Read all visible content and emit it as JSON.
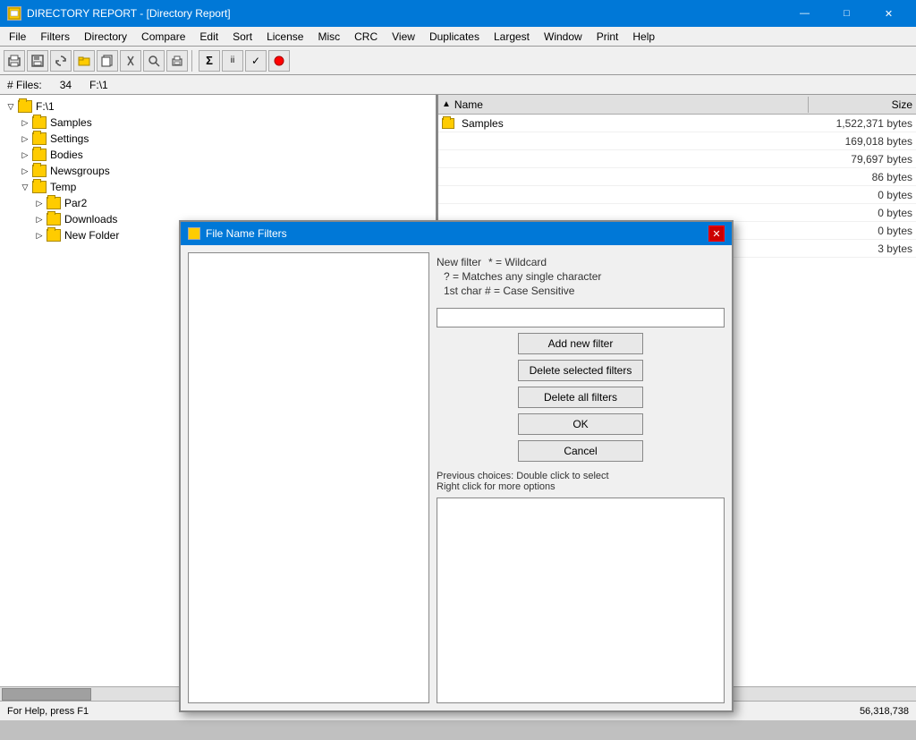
{
  "app": {
    "title": "DIRECTORY REPORT - [Directory Report]",
    "icon": "DR"
  },
  "titlebar": {
    "minimize": "—",
    "maximize": "□",
    "close": "✕"
  },
  "menubar": {
    "items": [
      "File",
      "Filters",
      "Directory",
      "Compare",
      "Edit",
      "Sort",
      "License",
      "Misc",
      "CRC",
      "View",
      "Duplicates",
      "Largest",
      "Window",
      "Print",
      "Help"
    ]
  },
  "fileinfo": {
    "files_label": "# Files:",
    "files_count": "34",
    "path": "F:\\1"
  },
  "tree": {
    "root": "F:\\1",
    "items": [
      {
        "label": "Samples",
        "indent": 1
      },
      {
        "label": "Settings",
        "indent": 1
      },
      {
        "label": "Bodies",
        "indent": 1
      },
      {
        "label": "Newsgroups",
        "indent": 1
      },
      {
        "label": "Temp",
        "indent": 1
      },
      {
        "label": "Par2",
        "indent": 2
      },
      {
        "label": "Downloads",
        "indent": 2
      },
      {
        "label": "New Folder",
        "indent": 2
      }
    ]
  },
  "filelist": {
    "header": {
      "name": "Name",
      "size": "Size"
    },
    "rows": [
      {
        "name": "Samples",
        "size": "1,522,371 bytes",
        "isFolder": true
      },
      {
        "name": "",
        "size": "169,018 bytes",
        "isFolder": false
      },
      {
        "name": "",
        "size": "79,697 bytes",
        "isFolder": false
      },
      {
        "name": "",
        "size": "86 bytes",
        "isFolder": false
      },
      {
        "name": "",
        "size": "0 bytes",
        "isFolder": false
      },
      {
        "name": "",
        "size": "0 bytes",
        "isFolder": false
      },
      {
        "name": "",
        "size": "0 bytes",
        "isFolder": false
      },
      {
        "name": "",
        "size": "3 bytes",
        "isFolder": false
      }
    ]
  },
  "dialog": {
    "title": "File Name Filters",
    "icon": "filter",
    "new_filter_label": "New filter",
    "hints": [
      "* = Wildcard",
      "? = Matches any single character",
      "1st char # = Case Sensitive"
    ],
    "input_placeholder": "",
    "buttons": {
      "add": "Add new filter",
      "delete_selected": "Delete selected filters",
      "delete_all": "Delete all filters",
      "ok": "OK",
      "cancel": "Cancel"
    },
    "prev_choices_line1": "Previous choices: Double click to select",
    "prev_choices_line2": "Right click for more options"
  },
  "statusbar": {
    "help_text": "For Help, press F1",
    "size_value": "56,318,738"
  }
}
